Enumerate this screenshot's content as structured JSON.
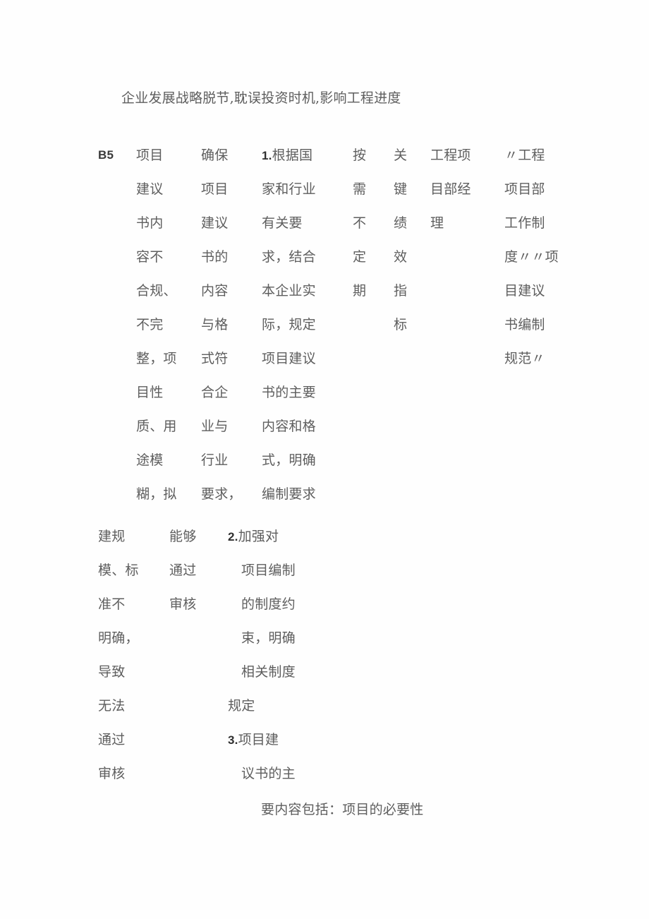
{
  "page": {
    "lead_line": "企业发展战略脱节,耽误投资时机,影响工程进度",
    "tail_line": "要内容包括：项目的必要性"
  },
  "table": {
    "row_id": "B5",
    "upper": {
      "col1": [
        "项目",
        "建议",
        "书内",
        "容不",
        "合规、",
        "不完",
        "整，项",
        "目性",
        "质、用",
        "途模",
        "糊，拟"
      ],
      "col2": [
        "确保",
        "项目",
        "建议",
        "书的",
        "内容",
        "与格",
        "式符",
        "合企",
        "业与",
        "行业",
        "要求，"
      ],
      "col3_num": "1.",
      "col3": [
        "根据国",
        "家和行业",
        "有关要",
        "求，结合",
        "本企业实",
        "际，规定",
        "项目建议",
        "书的主要",
        "内容和格",
        "式，明确",
        "编制要求"
      ],
      "col4": [
        "按",
        "需",
        "不",
        "定",
        "期"
      ],
      "col5": [
        "关",
        "键",
        "绩",
        "效",
        "指",
        "标"
      ],
      "col6": [
        "工程项",
        "目部经",
        "理"
      ],
      "col7": [
        "〃工程",
        "项目部",
        "工作制",
        "度〃〃项",
        "目建议",
        "书编制",
        "规范〃"
      ]
    },
    "lower": {
      "col1": [
        "建规",
        "模、标",
        "准不",
        "明确，",
        "导致",
        "无法",
        "通过",
        "审核"
      ],
      "col2": [
        "能够",
        "通过",
        "审核"
      ],
      "col3_items": [
        {
          "num": "2.",
          "first": "加强对",
          "rest": [
            "项目编制",
            "的制度约",
            "束，明确",
            "相关制度",
            "规定"
          ]
        },
        {
          "num": "3.",
          "first": "项目建",
          "rest": [
            "议书的主"
          ]
        }
      ]
    }
  }
}
